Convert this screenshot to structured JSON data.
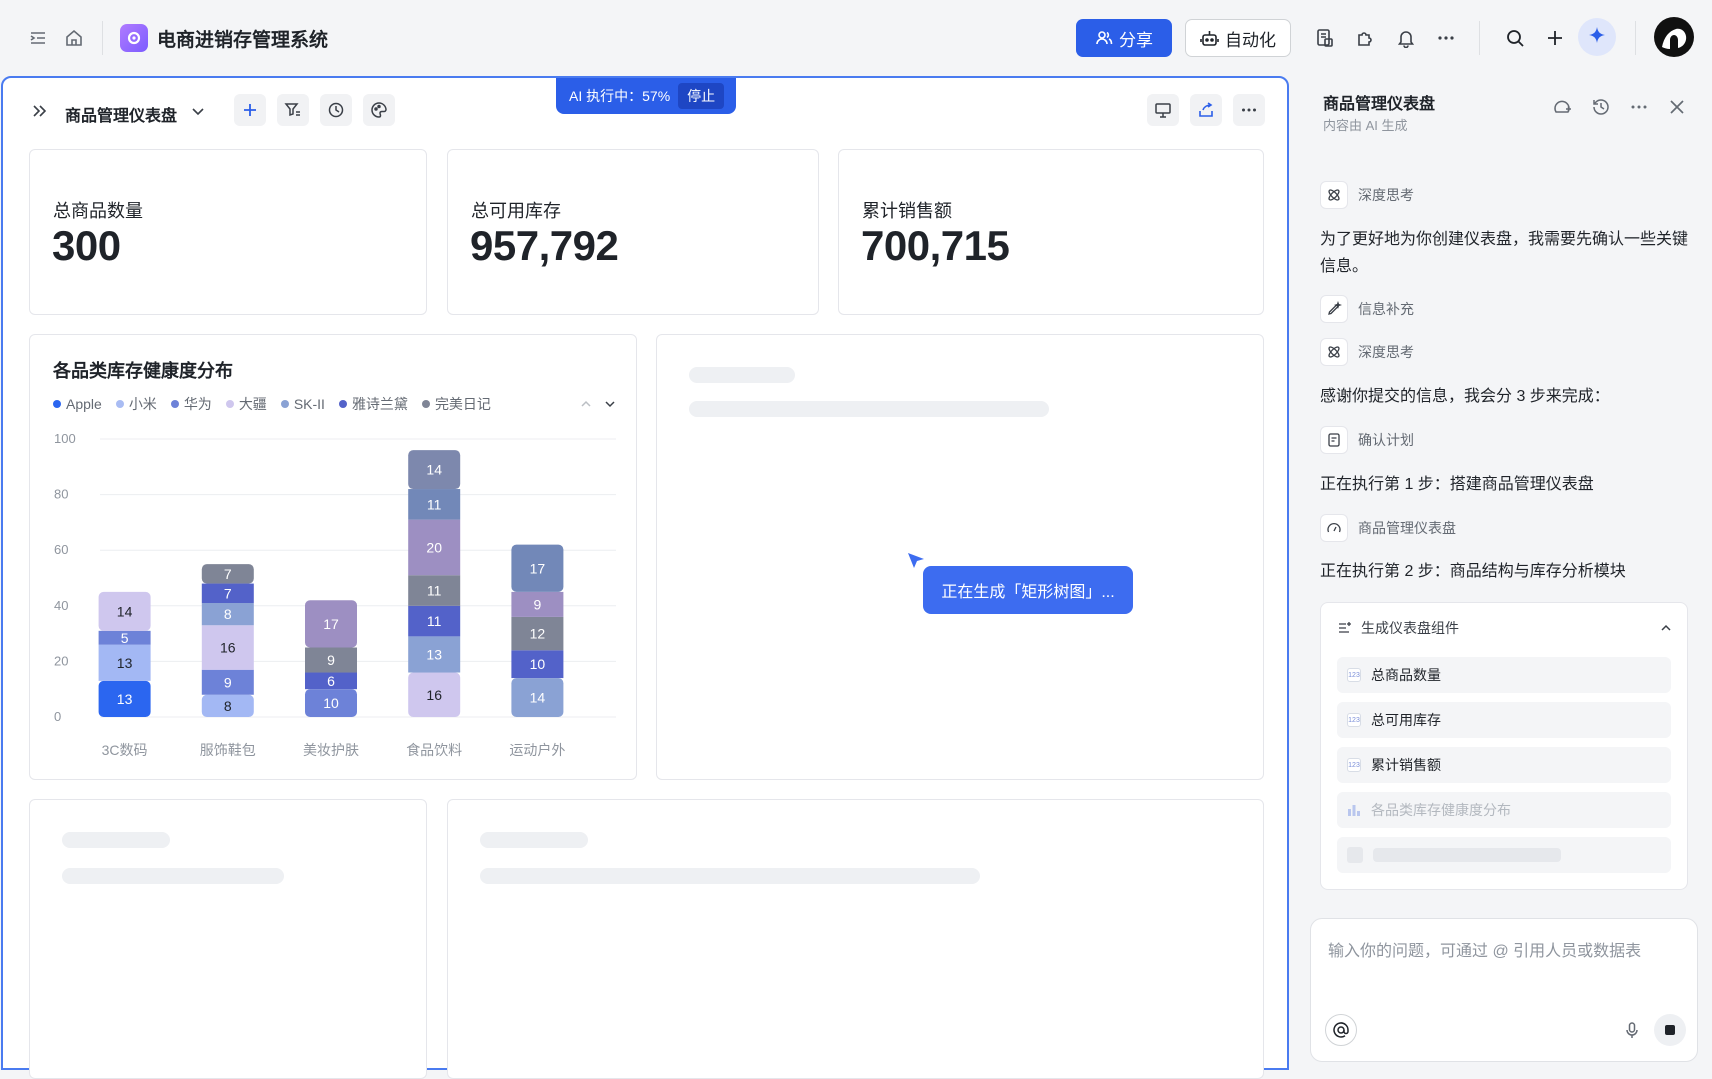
{
  "topbar": {
    "app_title": "电商进销存管理系统",
    "share_label": "分享",
    "automation_label": "自动化"
  },
  "dashboard": {
    "title": "商品管理仪表盘",
    "ai_status": "AI 执行中：57%",
    "ai_stop_label": "停止",
    "kpis": [
      {
        "label": "总商品数量",
        "value": "300"
      },
      {
        "label": "总可用库存",
        "value": "957,792"
      },
      {
        "label": "累计销售额",
        "value": "700,715"
      }
    ],
    "generating_tip": "正在生成「矩形树图」..."
  },
  "chart_data": {
    "type": "bar",
    "stacked": true,
    "title": "各品类库存健康度分布",
    "categories": [
      "3C数码",
      "服饰鞋包",
      "美妆护肤",
      "食品饮料",
      "运动户外"
    ],
    "ylim": [
      0,
      100
    ],
    "yticks": [
      0,
      20,
      40,
      60,
      80,
      100
    ],
    "grid": true,
    "legend_position": "top-left",
    "series": [
      {
        "name": "Apple",
        "color": "#2b66f0",
        "values": [
          13,
          0,
          0,
          0,
          0
        ]
      },
      {
        "name": "小米",
        "color": "#a3b8f4",
        "values": [
          13,
          8,
          0,
          0,
          0
        ]
      },
      {
        "name": "华为",
        "color": "#6d82d8",
        "values": [
          5,
          9,
          10,
          0,
          0
        ]
      },
      {
        "name": "大疆",
        "color": "#cfc7ee",
        "values": [
          14,
          16,
          0,
          16,
          0
        ]
      },
      {
        "name": "SK-II",
        "color": "#8aa2d4",
        "values": [
          0,
          8,
          0,
          13,
          14
        ]
      },
      {
        "name": "雅诗兰黛",
        "color": "#5362c9",
        "values": [
          0,
          7,
          6,
          11,
          10
        ]
      },
      {
        "name": "完美日记",
        "color": "#7f8596",
        "values": [
          0,
          7,
          9,
          11,
          12
        ]
      },
      {
        "name": "",
        "color": "#9d8fc2",
        "values": [
          0,
          0,
          17,
          20,
          9
        ]
      },
      {
        "name": "",
        "color": "#7288b8",
        "values": [
          0,
          0,
          0,
          11,
          17
        ]
      },
      {
        "name": "",
        "color": "#7d88ad",
        "values": [
          0,
          0,
          0,
          14,
          0
        ]
      }
    ]
  },
  "legend": [
    {
      "name": "Apple",
      "color": "#2b66f0"
    },
    {
      "name": "小米",
      "color": "#a9bcf3"
    },
    {
      "name": "华为",
      "color": "#6d82d8"
    },
    {
      "name": "大疆",
      "color": "#cfc7ee"
    },
    {
      "name": "SK-II",
      "color": "#8aa2d4"
    },
    {
      "name": "雅诗兰黛",
      "color": "#5362c9"
    },
    {
      "name": "完美日记",
      "color": "#7f8596"
    }
  ],
  "side_panel": {
    "title": "商品管理仪表盘",
    "subtitle": "内容由 AI 生成",
    "step_deep_think": "深度思考",
    "msg_intro": "为了更好地为你创建仪表盘，我需要先确认一些关键信息。",
    "step_info": "信息补充",
    "step_deep_think_2": "深度思考",
    "msg_thanks": "感谢你提交的信息，我会分 3 步来完成：",
    "step_plan": "确认计划",
    "msg_step1": "正在执行第 1 步：搭建商品管理仪表盘",
    "step_dash": "商品管理仪表盘",
    "msg_step2": "正在执行第 2 步：商品结构与库存分析模块",
    "gen_title": "生成仪表盘组件",
    "gen_items": [
      "总商品数量",
      "总可用库存",
      "累计销售额",
      "各品类库存健康度分布"
    ],
    "input_placeholder": "输入你的问题，可通过 @ 引用人员或数据表"
  }
}
